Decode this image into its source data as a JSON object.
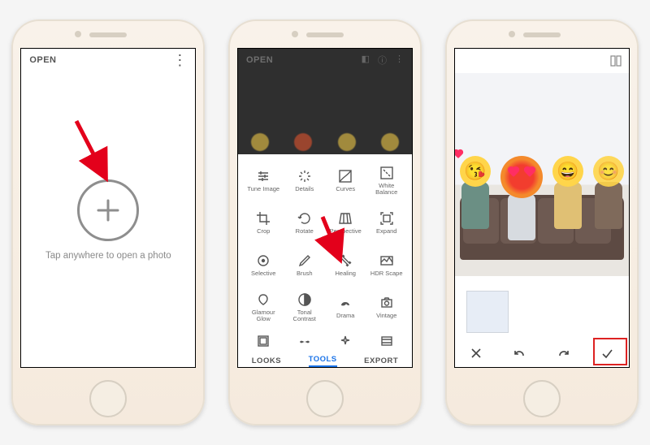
{
  "screen1": {
    "open_label": "OPEN",
    "hint": "Tap anywhere to open a photo"
  },
  "screen2": {
    "open_label": "OPEN",
    "tools": [
      {
        "label": "Tune Image"
      },
      {
        "label": "Details"
      },
      {
        "label": "Curves"
      },
      {
        "label": "White\nBalance"
      },
      {
        "label": "Crop"
      },
      {
        "label": "Rotate"
      },
      {
        "label": "Perspective"
      },
      {
        "label": "Expand"
      },
      {
        "label": "Selective"
      },
      {
        "label": "Brush"
      },
      {
        "label": "Healing"
      },
      {
        "label": "HDR Scape"
      },
      {
        "label": "Glamour\nGlow"
      },
      {
        "label": "Tonal\nContrast"
      },
      {
        "label": "Drama"
      },
      {
        "label": "Vintage"
      }
    ],
    "tabs": {
      "looks": "LOOKS",
      "tools": "TOOLS",
      "export": "EXPORT"
    }
  },
  "screen3": {
    "actions": {
      "close": "close",
      "undo": "undo",
      "redo": "redo",
      "confirm": "confirm"
    }
  }
}
